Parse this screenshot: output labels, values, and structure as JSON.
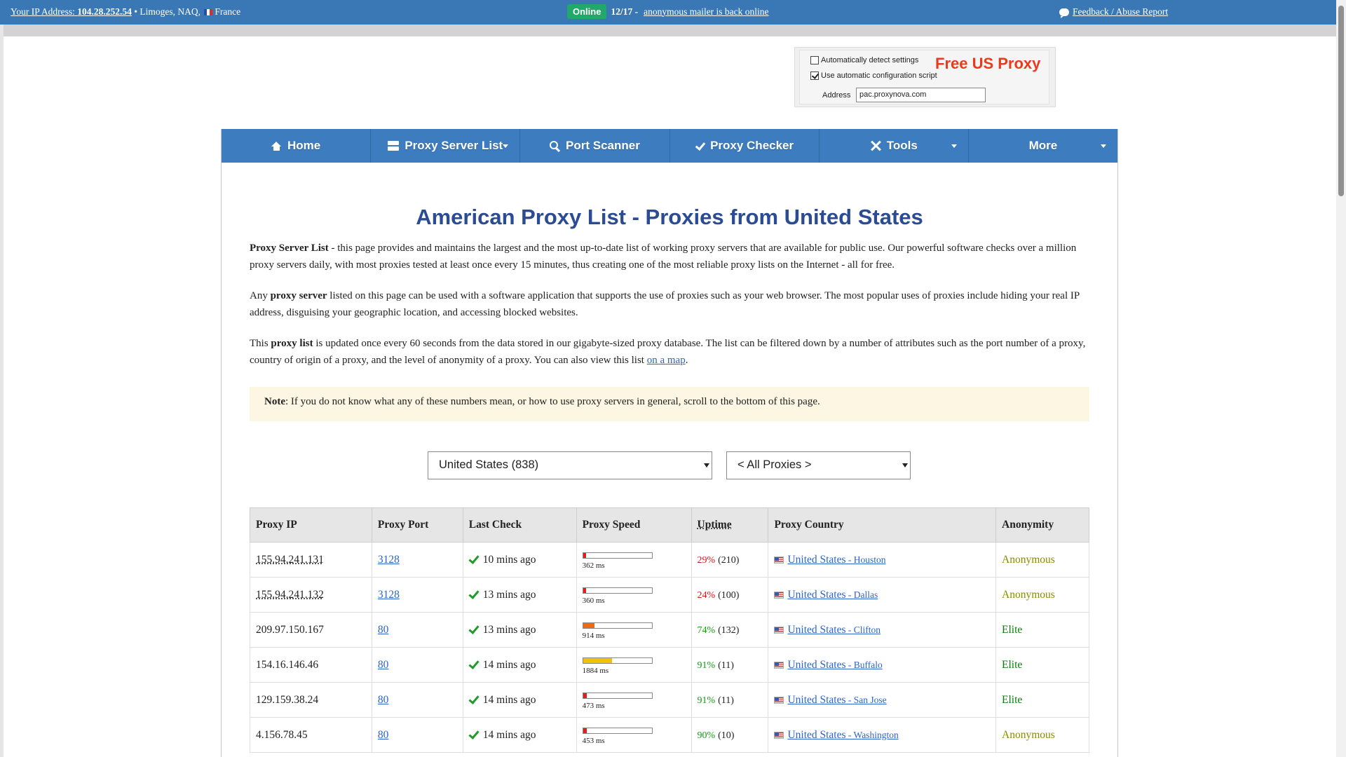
{
  "topbar": {
    "ip_label": "Your IP Address:",
    "ip_value": "104.28.252.54",
    "location": " • Limoges, NAQ,",
    "country": "France",
    "status_badge": "Online",
    "status_count": "12/17 -",
    "status_link": "anonymous mailer is back online",
    "feedback_link": "Feedback / Abuse Report"
  },
  "ad": {
    "option_auto_detect": "Automatically detect settings",
    "option_auto_config": "Use automatic configuration script",
    "title": "Free US Proxy",
    "address_label": "Address",
    "address_value": "pac.proxynova.com",
    "accent_color": "#ea3a1c"
  },
  "nav": {
    "items": [
      {
        "label": "Home",
        "icon": "home-icon"
      },
      {
        "label": "Proxy Server List",
        "icon": "server-icon",
        "dropdown": true
      },
      {
        "label": "Port Scanner",
        "icon": "search-icon"
      },
      {
        "label": "Proxy Checker",
        "icon": "check-icon"
      },
      {
        "label": "Tools",
        "icon": "tools-icon",
        "dropdown": true
      },
      {
        "label": "More",
        "dropdown": true
      }
    ],
    "bg_color": "#3d7dbf"
  },
  "main": {
    "title": "American Proxy List - Proxies from United States",
    "p1_bold": "Proxy Server List",
    "p1_text": " - this page provides and maintains the largest and the most up-to-date list of working proxy servers that are available for public use. Our powerful software checks over a million proxy servers daily, with most proxies tested at least once every 15 minutes, thus creating one of the most reliable proxy lists on the Internet - all for free.",
    "p2_a": "Any ",
    "p2_bold": "proxy server",
    "p2_b": " listed on this page can be used with a software application that supports the use of proxies such as your web browser. The most popular uses of proxies include hiding your real IP address, disguising your geographic location, and accessing blocked websites.",
    "p3_a": "This ",
    "p3_bold": "proxy list",
    "p3_b": " is updated once every 60 seconds from the data stored in our gigabyte-sized proxy database. The list can be filtered down by a number of attributes such as the port number of a proxy, country of origin of a proxy, and the level of anonymity of a proxy. You can also view this list ",
    "p3_link": "on a map",
    "p3_end": ".",
    "note_bold": "Note",
    "note_text": ": If you do not know what any of these numbers mean, or how to use proxy servers in general, scroll to the bottom of this page."
  },
  "filters": {
    "country_selected": "United States (838)",
    "anonymity_selected": "< All Proxies >"
  },
  "table": {
    "headers": [
      "Proxy IP",
      "Proxy Port",
      "Last Check",
      "Proxy Speed",
      "Uptime",
      "Proxy Country",
      "Anonymity"
    ],
    "rows": [
      {
        "ip": "155.94.241.131",
        "ip_abbr": true,
        "port": "3128",
        "last_check": "10 mins ago",
        "speed_ms": "362 ms",
        "speed_fill": 0.05,
        "speed_color": "#e02020",
        "uptime_pct": "29%",
        "uptime_count": "(210)",
        "uptime_color": "#d01818",
        "country": "United States",
        "city": " - Houston",
        "anonymity": "Anonymous"
      },
      {
        "ip": "155.94.241.132",
        "ip_abbr": true,
        "port": "3128",
        "last_check": "13 mins ago",
        "speed_ms": "360 ms",
        "speed_fill": 0.05,
        "speed_color": "#e02020",
        "uptime_pct": "24%",
        "uptime_count": "(100)",
        "uptime_color": "#d01818",
        "country": "United States",
        "city": " - Dallas",
        "anonymity": "Anonymous"
      },
      {
        "ip": "209.97.150.167",
        "ip_abbr": false,
        "port": "80",
        "last_check": "13 mins ago",
        "speed_ms": "914 ms",
        "speed_fill": 0.17,
        "speed_color": "#f06a10",
        "uptime_pct": "74%",
        "uptime_count": "(132)",
        "uptime_color": "#1a9a1a",
        "country": "United States",
        "city": " - Clifton",
        "anonymity": "Elite"
      },
      {
        "ip": "154.16.146.46",
        "ip_abbr": false,
        "port": "80",
        "last_check": "14 mins ago",
        "speed_ms": "1884 ms",
        "speed_fill": 0.42,
        "speed_color": "#f2c20a",
        "uptime_pct": "91%",
        "uptime_count": "(11)",
        "uptime_color": "#1a9a1a",
        "country": "United States",
        "city": " - Buffalo",
        "anonymity": "Elite"
      },
      {
        "ip": "129.159.38.24",
        "ip_abbr": false,
        "port": "80",
        "last_check": "14 mins ago",
        "speed_ms": "473 ms",
        "speed_fill": 0.06,
        "speed_color": "#e02020",
        "uptime_pct": "91%",
        "uptime_count": "(11)",
        "uptime_color": "#1a9a1a",
        "country": "United States",
        "city": " - San Jose",
        "anonymity": "Elite"
      },
      {
        "ip": "4.156.78.45",
        "ip_abbr": false,
        "port": "80",
        "last_check": "14 mins ago",
        "speed_ms": "453 ms",
        "speed_fill": 0.06,
        "speed_color": "#e02020",
        "uptime_pct": "90%",
        "uptime_count": "(10)",
        "uptime_color": "#1a9a1a",
        "country": "United States",
        "city": " - Washington",
        "anonymity": "Anonymous"
      }
    ]
  }
}
